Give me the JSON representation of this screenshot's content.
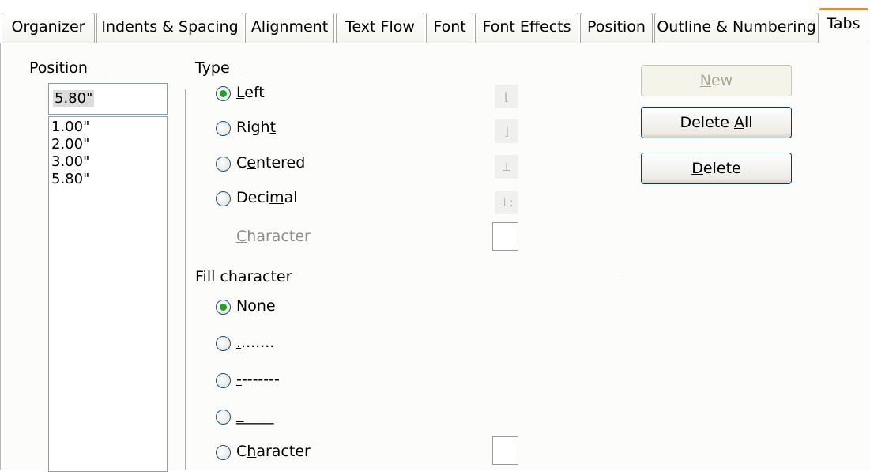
{
  "tabs": [
    {
      "label": "Organizer"
    },
    {
      "label": "Indents & Spacing"
    },
    {
      "label": "Alignment"
    },
    {
      "label": "Text Flow"
    },
    {
      "label": "Font"
    },
    {
      "label": "Font Effects"
    },
    {
      "label": "Position"
    },
    {
      "label": "Outline & Numbering"
    },
    {
      "label": "Tabs"
    }
  ],
  "position": {
    "legend": "Position",
    "value": "5.80\"",
    "items": [
      "1.00\"",
      "2.00\"",
      "3.00\"",
      "5.80\""
    ]
  },
  "type": {
    "legend": "Type",
    "options": [
      {
        "label_pre": "",
        "label_u": "L",
        "label_post": "eft",
        "checked": true,
        "glyph": "left-tab-icon"
      },
      {
        "label_pre": "Righ",
        "label_u": "t",
        "label_post": "",
        "checked": false,
        "glyph": "right-tab-icon"
      },
      {
        "label_pre": "C",
        "label_u": "e",
        "label_post": "ntered",
        "checked": false,
        "glyph": "center-tab-icon"
      },
      {
        "label_pre": "Deci",
        "label_u": "m",
        "label_post": "al",
        "checked": false,
        "glyph": "decimal-tab-icon"
      }
    ],
    "character_pre": "",
    "character_u": "C",
    "character_post": "haracter"
  },
  "fill": {
    "legend": "Fill character",
    "options": [
      {
        "label_pre": "N",
        "label_u": "o",
        "label_post": "ne",
        "checked": true
      },
      {
        "label_pre": "",
        "label_u": ".",
        "label_post": ".......",
        "checked": false
      },
      {
        "label_pre": "",
        "label_u": "-",
        "label_post": "-------",
        "checked": false
      },
      {
        "label_pre": "",
        "label_u": "_",
        "label_post": "____",
        "checked": false
      },
      {
        "label_pre": "C",
        "label_u": "h",
        "label_post": "aracter",
        "checked": false
      }
    ]
  },
  "buttons": {
    "new_u": "N",
    "new_post": "ew",
    "delete_all_pre": "Delete ",
    "delete_all_u": "A",
    "delete_all_post": "ll",
    "delete_u": "D",
    "delete_post": "elete"
  }
}
